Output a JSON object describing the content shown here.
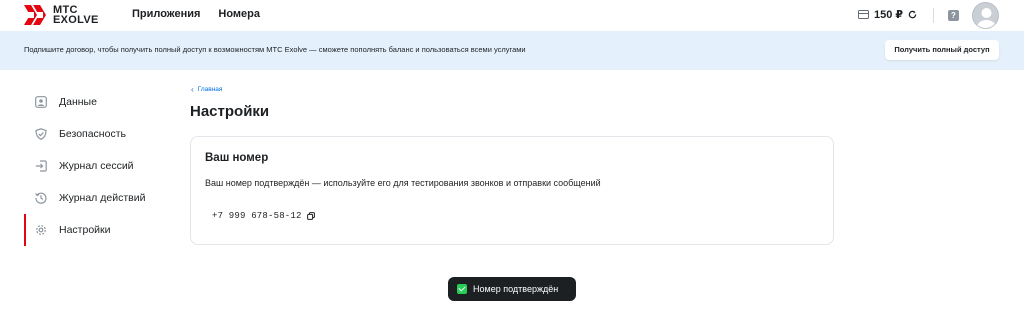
{
  "header": {
    "logo_line1": "МТС",
    "logo_line2": "EXOLVE",
    "nav": [
      "Приложения",
      "Номера"
    ],
    "balance": "150 ₽",
    "help_symbol": "?"
  },
  "banner": {
    "text": "Подпишите договор, чтобы получить полный доступ к возможностям МТС Exolve — сможете пополнять баланс и пользоваться всеми услугами",
    "button_label": "Получить полный доступ"
  },
  "sidebar": {
    "items": [
      {
        "label": "Данные",
        "icon": "person-card-icon"
      },
      {
        "label": "Безопасность",
        "icon": "shield-icon"
      },
      {
        "label": "Журнал сессий",
        "icon": "login-icon"
      },
      {
        "label": "Журнал действий",
        "icon": "history-icon"
      },
      {
        "label": "Настройки",
        "icon": "gear-icon",
        "active": true
      }
    ]
  },
  "breadcrumb": {
    "label": "Главная"
  },
  "page_title": "Настройки",
  "card": {
    "title": "Ваш номер",
    "description": "Ваш номер подтверждён — используйте его для тестирования звонков и отправки сообщений",
    "phone": "+7 999 678-58-12"
  },
  "toast": {
    "text": "Номер подтверждён"
  },
  "colors": {
    "brand_red": "#e30611",
    "banner_bg": "#e4f0fb",
    "link": "#0070e5",
    "toast_bg": "#1d2023",
    "success": "#26cd58"
  }
}
